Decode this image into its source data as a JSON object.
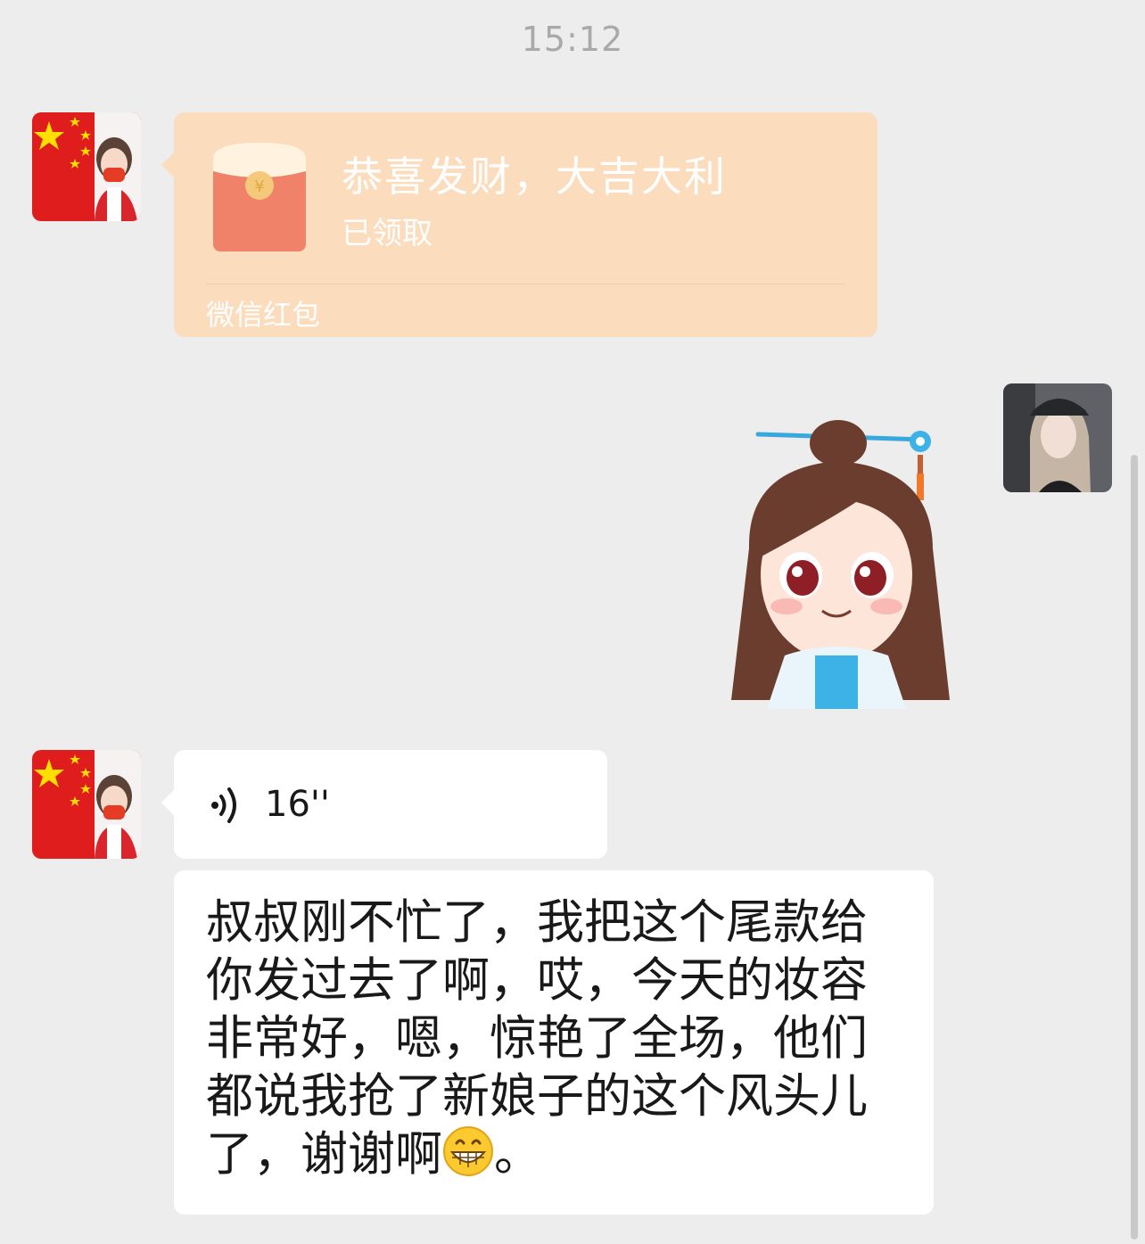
{
  "chat": {
    "timestamp": "15:12"
  },
  "messages": {
    "red_packet": {
      "title": "恭喜发财，大吉大利",
      "status": "已领取",
      "footer": "微信红包",
      "color": "#fbdcbc"
    },
    "voice": {
      "duration": "16''"
    },
    "text": {
      "content": "叔叔刚不忙了，我把这个尾款给你发过去了啊，哎，今天的妆容非常好，嗯，惊艳了全场，他们都说我抢了新娘子的这个风头儿了，谢谢啊",
      "emoji": "grinning-face",
      "end_punct": "。"
    }
  },
  "colors": {
    "background": "#ededed",
    "bubble": "#ffffff",
    "text": "#191919",
    "timestamp": "#a9a9a9"
  }
}
